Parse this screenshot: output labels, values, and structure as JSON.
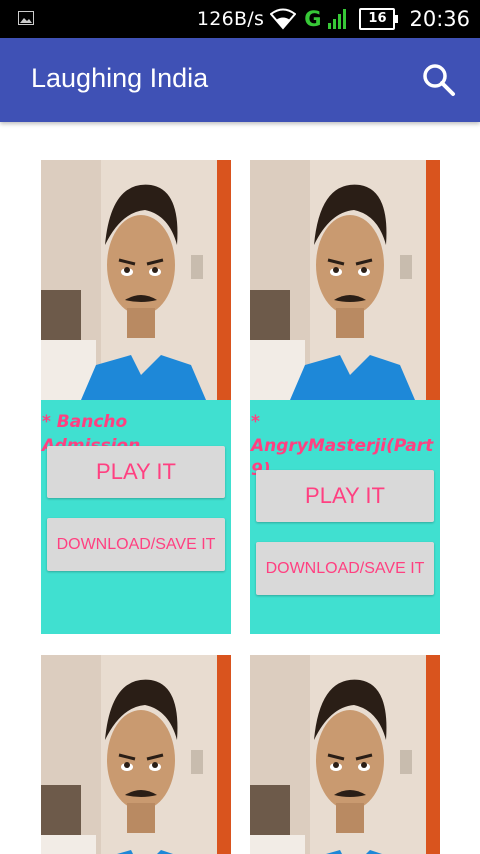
{
  "status_bar": {
    "net_speed": "126B/s",
    "network_type": "G",
    "battery": "16",
    "time": "20:36",
    "icons": [
      "gallery-icon",
      "wifi-icon",
      "signal-icon",
      "battery-icon"
    ]
  },
  "app_bar": {
    "title": "Laughing India",
    "search_icon": "search-icon"
  },
  "colors": {
    "app_bar": "#3f51b5",
    "card_bg": "#40e0d0",
    "accent_text": "#ff4081",
    "button_bg": "#d9d9d9"
  },
  "videos": [
    {
      "title": "* Bancho Admission",
      "play_label": "PLAY IT",
      "download_label": "DOWNLOAD/SAVE IT"
    },
    {
      "title": "* AngryMasterji(Part9)",
      "play_label": "PLAY IT",
      "download_label": "DOWNLOAD/SAVE IT"
    },
    {
      "title": "",
      "play_label": "",
      "download_label": ""
    },
    {
      "title": "",
      "play_label": "",
      "download_label": ""
    }
  ]
}
